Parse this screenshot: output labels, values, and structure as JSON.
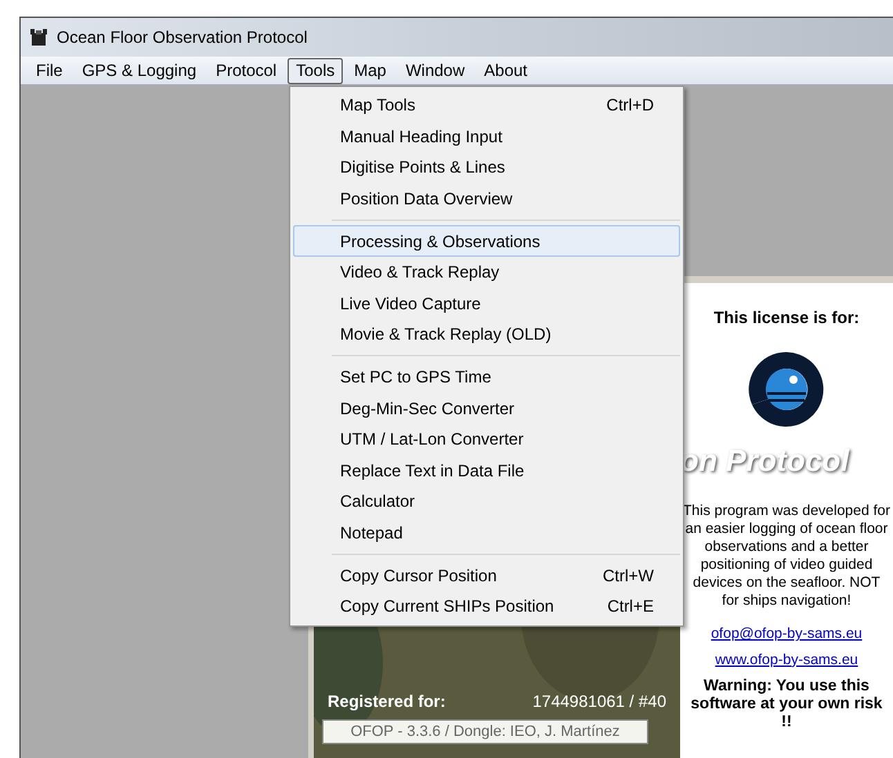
{
  "window": {
    "title": "Ocean Floor Observation Protocol"
  },
  "menu_bar": [
    {
      "label": "File",
      "selected": false
    },
    {
      "label": "GPS & Logging",
      "selected": false
    },
    {
      "label": "Protocol",
      "selected": false
    },
    {
      "label": "Tools",
      "selected": true
    },
    {
      "label": "Map",
      "selected": false
    },
    {
      "label": "Window",
      "selected": false
    },
    {
      "label": "About",
      "selected": false
    }
  ],
  "tools_menu": [
    {
      "kind": "item",
      "label": "Map Tools",
      "shortcut": "Ctrl+D",
      "selected": false
    },
    {
      "kind": "item",
      "label": "Manual Heading Input",
      "selected": false
    },
    {
      "kind": "item",
      "label": "Digitise Points & Lines",
      "selected": false
    },
    {
      "kind": "item",
      "label": "Position Data Overview",
      "selected": false
    },
    {
      "kind": "separator"
    },
    {
      "kind": "item",
      "label": "Processing & Observations",
      "selected": true
    },
    {
      "kind": "item",
      "label": "Video & Track Replay",
      "selected": false
    },
    {
      "kind": "item",
      "label": "Live Video Capture",
      "selected": false
    },
    {
      "kind": "item",
      "label": "Movie & Track Replay (OLD)",
      "selected": false
    },
    {
      "kind": "separator"
    },
    {
      "kind": "item",
      "label": "Set PC to GPS Time",
      "selected": false
    },
    {
      "kind": "item",
      "label": "Deg-Min-Sec Converter",
      "selected": false
    },
    {
      "kind": "item",
      "label": "UTM / Lat-Lon Converter",
      "selected": false
    },
    {
      "kind": "item",
      "label": "Replace Text in Data File",
      "selected": false
    },
    {
      "kind": "item",
      "label": "Calculator",
      "selected": false
    },
    {
      "kind": "item",
      "label": "Notepad",
      "selected": false
    },
    {
      "kind": "separator"
    },
    {
      "kind": "item",
      "label": "Copy Cursor Position",
      "shortcut": "Ctrl+W",
      "selected": false
    },
    {
      "kind": "item",
      "label": "Copy Current SHIPs Position",
      "shortcut": "Ctrl+E",
      "selected": false
    }
  ],
  "splash": {
    "registered_label": "Registered for:",
    "registration": "1744981061 / #40",
    "version_field": "OFOP - 3.3.6 / Dongle: IEO, J. Martínez",
    "license_heading": "This license is for:",
    "logo_text": "on Protocol",
    "description": "This program was developed for an easier logging of ocean floor observations and a better positioning of video guided devices on the seafloor. NOT for ships navigation!",
    "email": "ofop@ofop-by-sams.eu",
    "website": "www.ofop-by-sams.eu",
    "warning": "Warning: You use this software at your own risk !!"
  }
}
